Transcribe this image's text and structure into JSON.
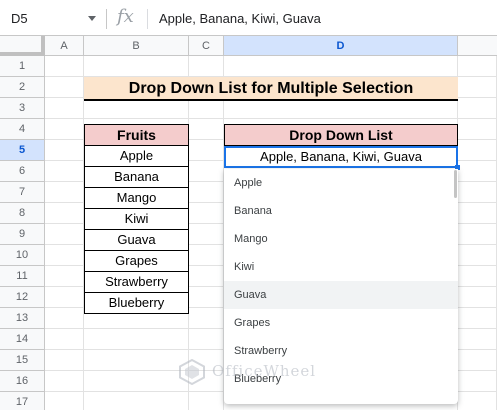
{
  "formula_bar": {
    "name_box": "D5",
    "fx_label": "fx",
    "value": "Apple, Banana, Kiwi, Guava"
  },
  "columns": [
    "A",
    "B",
    "C",
    "D"
  ],
  "rows": [
    "1",
    "2",
    "3",
    "4",
    "5",
    "6",
    "7",
    "8",
    "9",
    "10",
    "11",
    "12",
    "13",
    "14",
    "15",
    "16",
    "17"
  ],
  "selected_cell": {
    "column": "D",
    "row": "5"
  },
  "title": "Drop Down List for Multiple Selection",
  "fruits_header": "Fruits",
  "fruits": [
    "Apple",
    "Banana",
    "Mango",
    "Kiwi",
    "Guava",
    "Grapes",
    "Strawberry",
    "Blueberry"
  ],
  "dropdown_header": "Drop Down List",
  "dropdown_value": "Apple, Banana, Kiwi, Guava",
  "dropdown_options": [
    "Apple",
    "Banana",
    "Mango",
    "Kiwi",
    "Guava",
    "Grapes",
    "Strawberry",
    "Blueberry"
  ],
  "hovered_option": "Guava",
  "watermark": "OfficeWheel",
  "colors": {
    "title_fill": "#fce5cd",
    "header_fill": "#f4cccc",
    "selection_blue": "#1a73e8"
  }
}
